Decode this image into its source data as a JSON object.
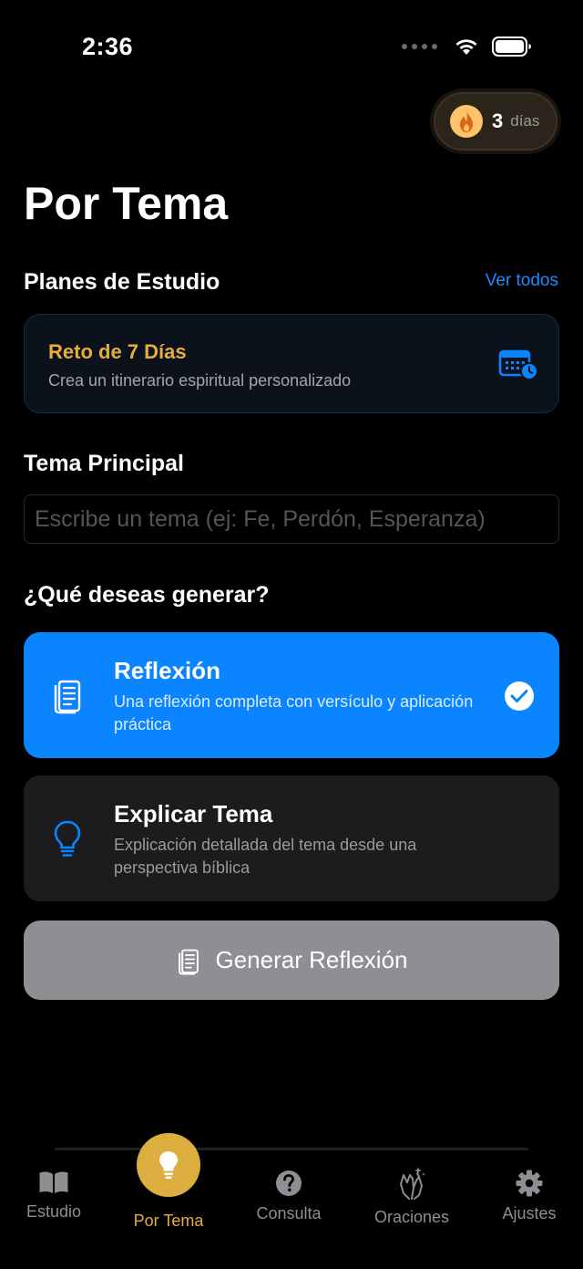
{
  "status": {
    "time": "2:36"
  },
  "streak": {
    "count": "3",
    "unit": "días"
  },
  "page": {
    "title": "Por Tema"
  },
  "plans": {
    "section_title": "Planes de Estudio",
    "see_all": "Ver todos",
    "card": {
      "title": "Reto de 7 Días",
      "subtitle": "Crea un itinerario espiritual personalizado"
    }
  },
  "topic": {
    "section_title": "Tema Principal",
    "placeholder": "Escribe un tema (ej: Fe, Perdón, Esperanza)",
    "value": ""
  },
  "generate_type": {
    "section_title": "¿Qué deseas generar?",
    "options": [
      {
        "title": "Reflexión",
        "description": "Una reflexión completa con versículo y aplicación práctica",
        "selected": true
      },
      {
        "title": "Explicar Tema",
        "description": "Explicación detallada del tema desde una perspectiva bíblica",
        "selected": false
      }
    ]
  },
  "generate_button": {
    "label": "Generar Reflexión"
  },
  "tabbar": {
    "items": [
      {
        "label": "Estudio",
        "icon": "book-icon",
        "active": false
      },
      {
        "label": "Por Tema",
        "icon": "lightbulb-icon",
        "active": true
      },
      {
        "label": "Consulta",
        "icon": "question-icon",
        "active": false
      },
      {
        "label": "Oraciones",
        "icon": "praying-hands-icon",
        "active": false
      },
      {
        "label": "Ajustes",
        "icon": "gear-icon",
        "active": false
      }
    ]
  },
  "colors": {
    "accent_blue": "#0a84ff",
    "accent_gold": "#e6ac3d",
    "card_dark": "#1c1c1e",
    "button_disabled": "#8e8e93"
  }
}
